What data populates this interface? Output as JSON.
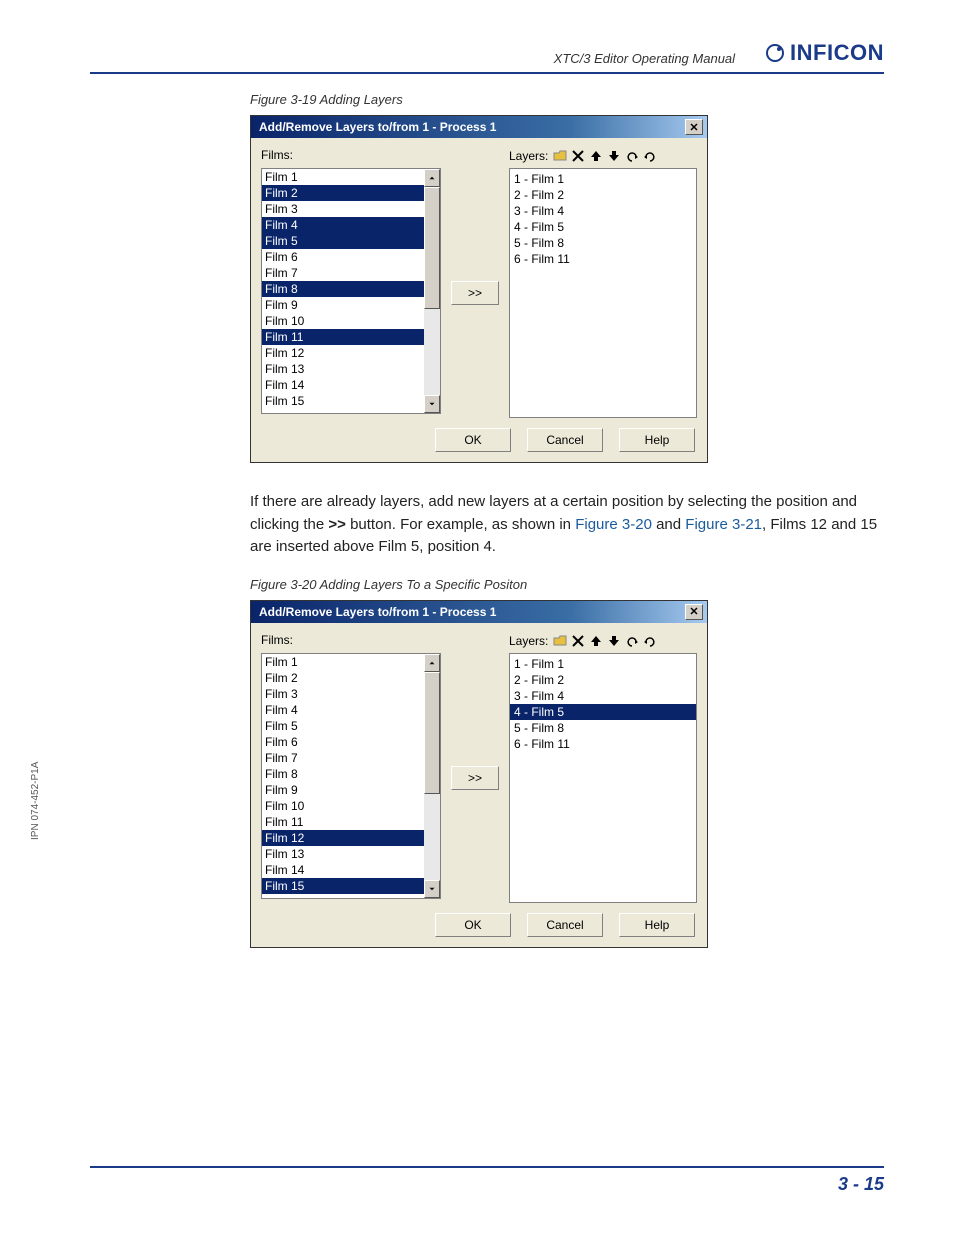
{
  "header": {
    "manual_title": "XTC/3 Editor Operating Manual",
    "brand": "INFICON"
  },
  "side_label": "IPN 074-452-P1A",
  "page_number": "3 - 15",
  "fig19": {
    "caption": "Figure 3-19  Adding Layers",
    "title": "Add/Remove Layers to/from 1 - Process 1",
    "films_label": "Films:",
    "layers_label": "Layers:",
    "move_label": ">>",
    "ok": "OK",
    "cancel": "Cancel",
    "help": "Help",
    "films": [
      {
        "t": "Film 1",
        "sel": false
      },
      {
        "t": "Film 2",
        "sel": true
      },
      {
        "t": "Film 3",
        "sel": false
      },
      {
        "t": "Film 4",
        "sel": true
      },
      {
        "t": "Film 5",
        "sel": true
      },
      {
        "t": "Film 6",
        "sel": false
      },
      {
        "t": "Film 7",
        "sel": false
      },
      {
        "t": "Film 8",
        "sel": true
      },
      {
        "t": "Film 9",
        "sel": false
      },
      {
        "t": "Film 10",
        "sel": false
      },
      {
        "t": "Film 11",
        "sel": true
      },
      {
        "t": "Film 12",
        "sel": false
      },
      {
        "t": "Film 13",
        "sel": false
      },
      {
        "t": "Film 14",
        "sel": false
      },
      {
        "t": "Film 15",
        "sel": false
      }
    ],
    "layers": [
      {
        "t": "1 - Film 1",
        "sel": false
      },
      {
        "t": "2 - Film 2",
        "sel": false
      },
      {
        "t": "3 - Film 4",
        "sel": false
      },
      {
        "t": "4 - Film 5",
        "sel": false
      },
      {
        "t": "5 - Film 8",
        "sel": false
      },
      {
        "t": "6 - Film 11",
        "sel": false
      }
    ],
    "thumb": {
      "top": 0,
      "height": 120
    }
  },
  "body": {
    "t1": "If there are already layers, add new layers at a certain position by selecting the position and clicking the ",
    "bold": ">>",
    "t2": " button. For example, as shown in ",
    "link1": "Figure 3-20",
    "t3": " and ",
    "link2": "Figure 3-21",
    "t4": ", Films 12 and 15 are inserted above Film 5, position 4."
  },
  "fig20": {
    "caption": "Figure 3-20  Adding Layers To a Specific Positon",
    "title": "Add/Remove Layers to/from 1 - Process 1",
    "films_label": "Films:",
    "layers_label": "Layers:",
    "move_label": ">>",
    "ok": "OK",
    "cancel": "Cancel",
    "help": "Help",
    "films": [
      {
        "t": "Film 1",
        "sel": false
      },
      {
        "t": "Film 2",
        "sel": false
      },
      {
        "t": "Film 3",
        "sel": false
      },
      {
        "t": "Film 4",
        "sel": false
      },
      {
        "t": "Film 5",
        "sel": false
      },
      {
        "t": "Film 6",
        "sel": false
      },
      {
        "t": "Film 7",
        "sel": false
      },
      {
        "t": "Film 8",
        "sel": false
      },
      {
        "t": "Film 9",
        "sel": false
      },
      {
        "t": "Film 10",
        "sel": false
      },
      {
        "t": "Film 11",
        "sel": false
      },
      {
        "t": "Film 12",
        "sel": true
      },
      {
        "t": "Film 13",
        "sel": false
      },
      {
        "t": "Film 14",
        "sel": false
      },
      {
        "t": "Film 15",
        "sel": true
      }
    ],
    "layers": [
      {
        "t": "1 - Film 1",
        "sel": false
      },
      {
        "t": "2 - Film 2",
        "sel": false
      },
      {
        "t": "3 - Film 4",
        "sel": false
      },
      {
        "t": "4 - Film 5",
        "sel": true
      },
      {
        "t": "5 - Film 8",
        "sel": false
      },
      {
        "t": "6 - Film 11",
        "sel": false
      }
    ],
    "thumb": {
      "top": 0,
      "height": 120
    }
  }
}
